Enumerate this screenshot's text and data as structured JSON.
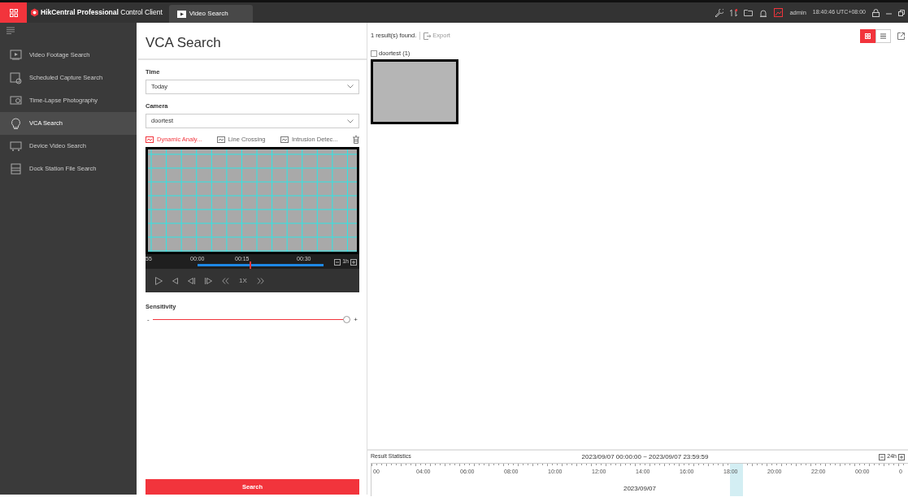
{
  "title_bar": {
    "app_name_bold": "HikCentral Professional",
    "app_name_rest": "Control Client",
    "tabs": [
      {
        "label": "Video Search",
        "selected": true
      }
    ],
    "user": "admin",
    "time": "18:40:46 UTC+08:00"
  },
  "sidebar": {
    "items": [
      {
        "label": "Video Footage Search",
        "selected": false,
        "kind": "footage"
      },
      {
        "label": "Scheduled Capture Search",
        "selected": false,
        "kind": "capture"
      },
      {
        "label": "Time-Lapse Photography",
        "selected": false,
        "kind": "timelapse"
      },
      {
        "label": "VCA Search",
        "selected": true,
        "kind": "vca"
      },
      {
        "label": "Device Video Search",
        "selected": false,
        "kind": "device"
      },
      {
        "label": "Dock Station File Search",
        "selected": false,
        "kind": "dock"
      }
    ]
  },
  "search_panel": {
    "title": "VCA Search",
    "fields": [
      {
        "label": "Time",
        "value": "Today"
      },
      {
        "label": "Camera",
        "value": "doortest"
      }
    ],
    "rule_tabs": [
      {
        "label": "Dynamic Analy...",
        "selected": true
      },
      {
        "label": "Line Crossing",
        "selected": false
      },
      {
        "label": "Intrusion Detec...",
        "selected": false
      }
    ],
    "player": {
      "timeline_labels": [
        "55",
        "00:00",
        "00:15",
        "00:30"
      ],
      "zoom_label": "1h",
      "speed": "1X"
    },
    "sensitivity": {
      "label": "Sensitivity",
      "minus": "-",
      "plus": "+",
      "level": 1
    },
    "search_button": "Search"
  },
  "results": {
    "count": "1 result(s) found.",
    "export": {
      "label": "Export",
      "disabled": true
    },
    "view_modes": [
      {
        "kind": "grid",
        "selected": true
      },
      {
        "kind": "list",
        "selected": false
      }
    ],
    "groups": [
      {
        "label": "doortest (1)",
        "checked": false
      }
    ],
    "statistics": {
      "title": "Result Statistics",
      "range": "2023/09/07 00:00:00 ~ 2023/09/07 23:59:59",
      "zoom_label": "24h",
      "axis_labels": [
        "00",
        "04:00",
        "06:00",
        "08:00",
        "10:00",
        "12:00",
        "14:00",
        "16:00",
        "18:00",
        "20:00",
        "22:00",
        "00:00",
        "0"
      ],
      "date": "2023/09/07"
    }
  }
}
